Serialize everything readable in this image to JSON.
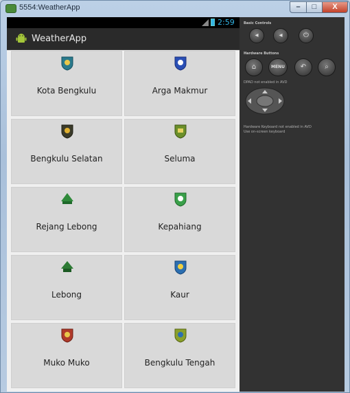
{
  "window": {
    "title": "5554:WeatherApp",
    "controls": {
      "minimize": "–",
      "maximize": "□",
      "close": "X"
    }
  },
  "statusbar": {
    "time": "2:59"
  },
  "actionbar": {
    "title": "WeatherApp",
    "icon": "android-icon"
  },
  "regions": [
    {
      "name": "Kota Bengkulu",
      "logo_color": "#2a7a8c"
    },
    {
      "name": "Arga Makmur",
      "logo_color": "#2a4fb5"
    },
    {
      "name": "Bengkulu Selatan",
      "logo_color": "#3b3b2a"
    },
    {
      "name": "Seluma",
      "logo_color": "#6b8f2a"
    },
    {
      "name": "Rejang Lebong",
      "logo_color": "#2f8a3a"
    },
    {
      "name": "Kepahiang",
      "logo_color": "#3aa04a"
    },
    {
      "name": "Lebong",
      "logo_color": "#2d7a34"
    },
    {
      "name": "Kaur",
      "logo_color": "#2c6fb0"
    },
    {
      "name": "Muko Muko",
      "logo_color": "#b03a2a"
    },
    {
      "name": "Bengkulu Tengah",
      "logo_color": "#8aa02a"
    }
  ],
  "emulator_controls": {
    "basic_controls_label": "Basic Controls",
    "hardware_buttons_label": "Hardware Buttons",
    "menu_label": "MENU",
    "dpad_note": "DPAD not enabled in AVD",
    "keyboard_note_1": "Hardware Keyboard not enabled in AVD",
    "keyboard_note_2": "Use on-screen keyboard"
  },
  "colors": {
    "accent": "#33b5e5",
    "tile": "#d9d9d9",
    "actionbar": "#2a2a2a"
  }
}
